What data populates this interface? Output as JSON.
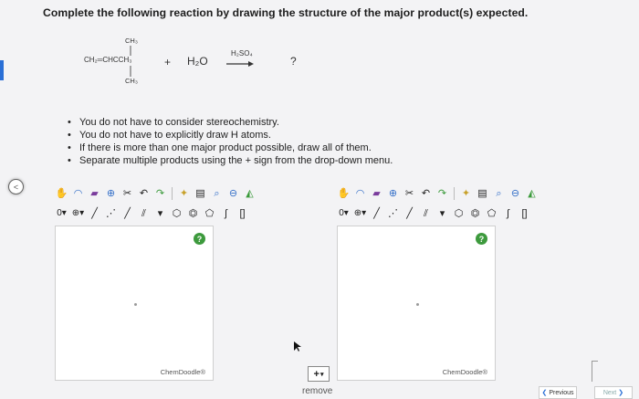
{
  "question": {
    "prompt": "Complete the following reaction by drawing the structure of the major product(s) expected.",
    "reaction": {
      "ch3_top": "CH₃",
      "reactant": "CH₂═CHCCH₃",
      "ch3_bottom": "CH₃",
      "plus": "+",
      "water": "H₂O",
      "reagent": "H₂SO₄",
      "product": "?"
    },
    "instructions": [
      "You do not have to consider stereochemistry.",
      "You do not have to explicitly draw H atoms.",
      "If there is more than one major product possible, draw all of them.",
      "Separate multiple products using the + sign from the drop-down menu."
    ]
  },
  "editors": [
    {
      "help_label": "?",
      "brand": "ChemDoodle®"
    },
    {
      "help_label": "?",
      "brand": "ChemDoodle®"
    }
  ],
  "toolbar": {
    "row1_icons": [
      "hand-icon",
      "lasso-icon",
      "eraser-icon",
      "zoom-plus-icon",
      "scissors-icon",
      "undo-icon",
      "redo-icon",
      "clean-icon",
      "template-icon",
      "search-zoom-icon",
      "zoom-out-icon",
      "transform-icon"
    ],
    "row2_icons": [
      "charge-icon",
      "add-atom-icon",
      "single-bond-icon",
      "dashed-bond-icon",
      "bond-icon",
      "double-bond-icon",
      "triple-bond-icon",
      "ring-icon",
      "benzene-icon",
      "pentagon-icon",
      "text-icon",
      "bracket-icon"
    ]
  },
  "separator_select": {
    "value": "+"
  },
  "remove_label": "remove",
  "navigation": {
    "previous": "Previous",
    "next": "Next"
  },
  "colors": {
    "accent": "#2a6fd6",
    "help": "#3d9a3d"
  }
}
